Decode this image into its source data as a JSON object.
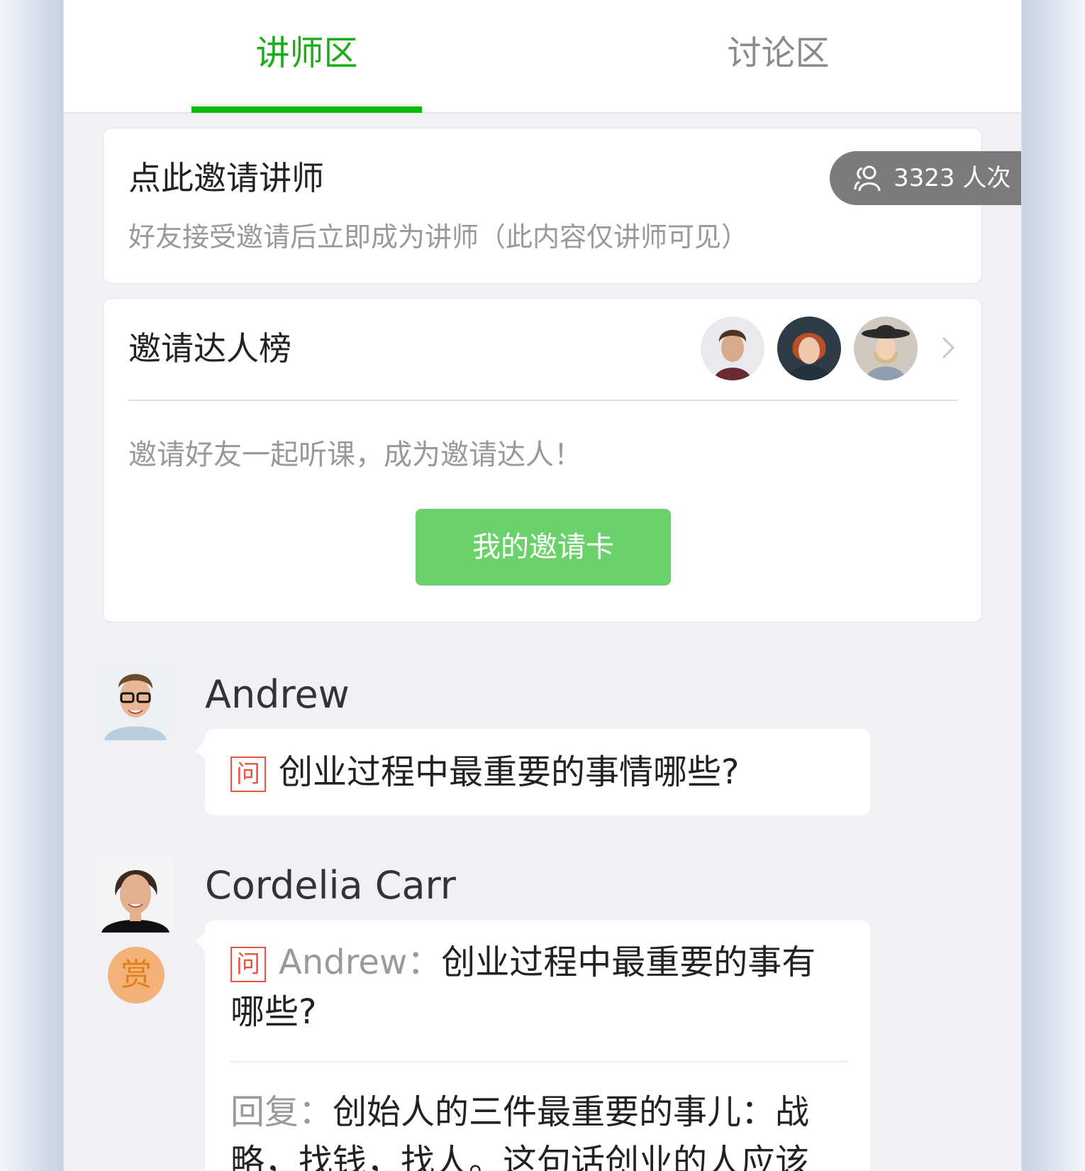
{
  "tabs": {
    "lecturer": "讲师区",
    "discussion": "讨论区"
  },
  "invite_card": {
    "title": "点此邀请讲师",
    "description": "好友接受邀请后立即成为讲师（此内容仅讲师可见）"
  },
  "visits": {
    "count": "3323",
    "unit": "人次",
    "icon": "people-icon"
  },
  "rank_card": {
    "title": "邀请达人榜",
    "description": "邀请好友一起听课，成为邀请达人！",
    "button": "我的邀请卡"
  },
  "messages": [
    {
      "name": "Andrew",
      "badge": "问",
      "text": "创业过程中最重要的事情哪些?"
    },
    {
      "name": "Cordelia Carr",
      "reward": "赏",
      "badge": "问",
      "quote_author": "Andrew",
      "quote_sep": "：",
      "quote_text_line1": "创业过程中最重要的事有",
      "quote_text_line2": "哪些?",
      "reply_label": "回复：",
      "reply_line1": "创始人的三件最重要的事儿：战",
      "reply_line2": "略，找钱，找人。这句话创业的人应该"
    }
  ],
  "colors": {
    "accent": "#09bb07",
    "button": "#6bd16b",
    "question_badge": "#e8543d",
    "reward": "#f2b27a"
  }
}
